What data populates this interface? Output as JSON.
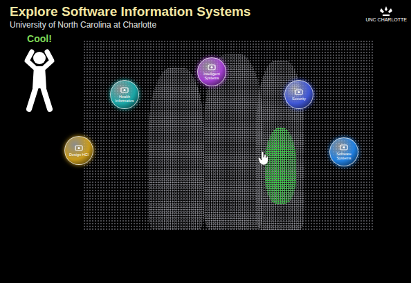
{
  "header": {
    "title": "Explore Software Information Systems",
    "subtitle": "University of North Carolina at Charlotte",
    "logo": "UNC CHARLOTTE"
  },
  "gesture": {
    "label": "Cool!"
  },
  "bubbles": [
    {
      "label": "Health Informatics",
      "color": "#1aa6a6"
    },
    {
      "label": "Intelligent Systems",
      "color": "#a23fd0"
    },
    {
      "label": "Security",
      "color": "#3f56d6"
    },
    {
      "label": "Design HCI",
      "color": "#c79a1c"
    },
    {
      "label": "Software Systems",
      "color": "#1f7fe0"
    }
  ]
}
